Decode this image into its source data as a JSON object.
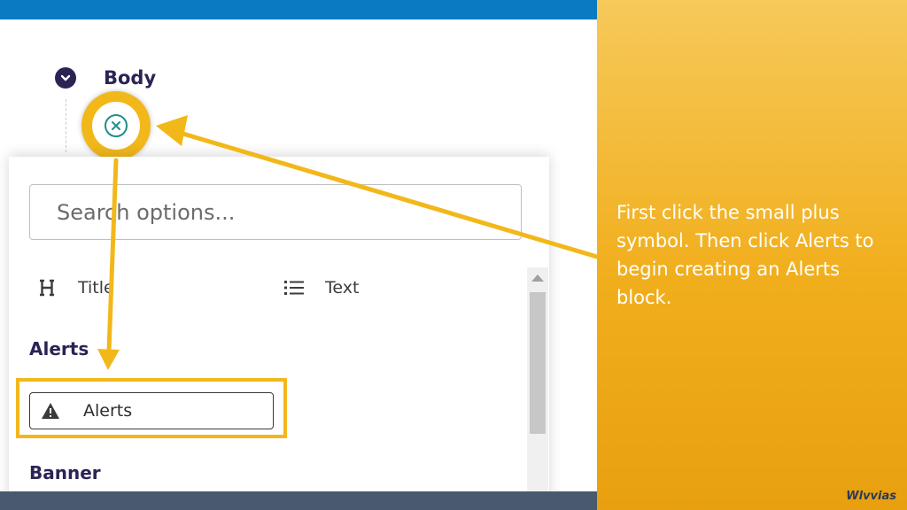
{
  "section": {
    "title": "Body",
    "toggle_icon": "chevron-down-icon"
  },
  "add_button": {
    "icon": "plus-circle-icon"
  },
  "search": {
    "placeholder": "Search options..."
  },
  "options": [
    {
      "label": "Title",
      "icon": "heading-icon"
    },
    {
      "label": "Text",
      "icon": "list-icon"
    }
  ],
  "groups": {
    "alerts": {
      "title": "Alerts",
      "item_label": "Alerts",
      "item_icon": "warning-icon"
    },
    "banner": {
      "title": "Banner"
    }
  },
  "caption": {
    "text": "First click the small plus symbol. Then click Alerts to begin creating an Alerts block."
  },
  "brand": {
    "text": "Wlvvias"
  },
  "colors": {
    "accent": "#f2b81a",
    "heading": "#2a2454",
    "top_bar": "#0a7ac2",
    "panel": "#f1ae1c"
  }
}
